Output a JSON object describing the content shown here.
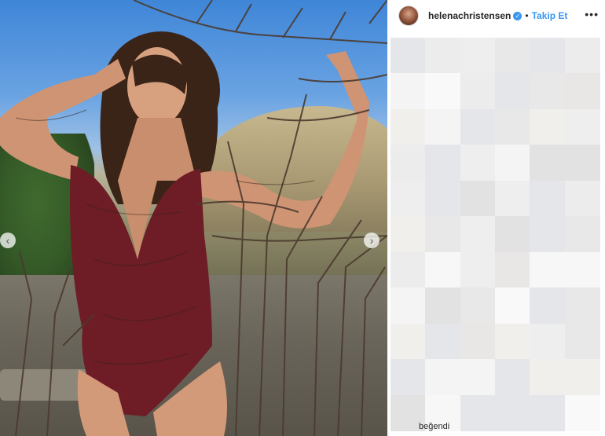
{
  "post": {
    "username": "helenachristensen",
    "verified_icon": "verified-badge-icon",
    "separator": "•",
    "follow_label": "Takip Et",
    "more_icon": "more-horizontal-icon",
    "avatar_icon": "avatar",
    "image_semantic": "woman-in-burgundy-swimsuit-among-bare-branches"
  },
  "carousel": {
    "prev_icon": "chevron-left-icon",
    "next_icon": "chevron-right-icon",
    "prev_glyph": "‹",
    "next_glyph": "›"
  },
  "footer": {
    "likes_label": "beğendi"
  },
  "colors": {
    "accent": "#3897f0",
    "text": "#262626"
  }
}
